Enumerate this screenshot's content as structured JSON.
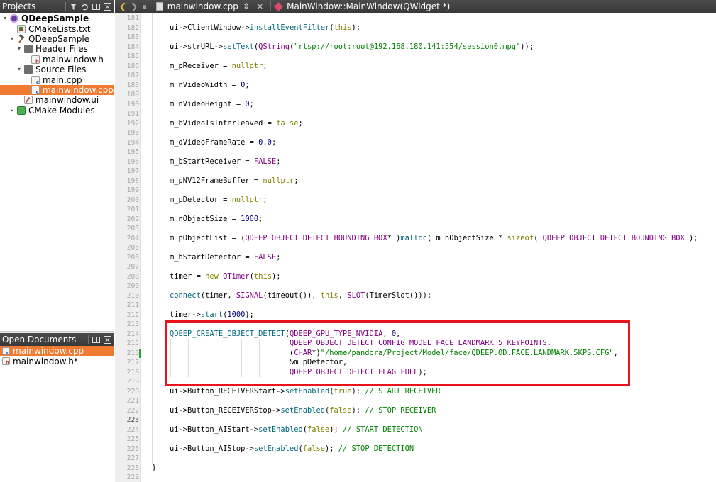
{
  "projects_panel": {
    "title": "Projects",
    "tree": [
      {
        "label": "QDeepSample",
        "icon": "project-icon",
        "depth": 0,
        "expanded": true,
        "bold": true
      },
      {
        "label": "CMakeLists.txt",
        "icon": "cmake-file-icon",
        "depth": 1
      },
      {
        "label": "QDeepSample",
        "icon": "hammer-icon",
        "depth": 1,
        "expanded": true
      },
      {
        "label": "Header Files",
        "icon": "folder-icon",
        "depth": 2,
        "expanded": true
      },
      {
        "label": "mainwindow.h",
        "icon": "header-file-icon",
        "depth": 3
      },
      {
        "label": "Source Files",
        "icon": "folder-icon",
        "depth": 2,
        "expanded": true
      },
      {
        "label": "main.cpp",
        "icon": "cpp-file-icon",
        "depth": 3
      },
      {
        "label": "mainwindow.cpp",
        "icon": "cpp-file-icon",
        "depth": 3,
        "selected": true
      },
      {
        "label": "mainwindow.ui",
        "icon": "ui-file-icon",
        "depth": 2
      },
      {
        "label": "CMake Modules",
        "icon": "cmake-modules-icon",
        "depth": 1,
        "expanded": false
      }
    ]
  },
  "open_documents": {
    "title": "Open Documents",
    "items": [
      {
        "label": "mainwindow.cpp",
        "selected": true
      },
      {
        "label": "mainwindow.h*",
        "selected": false
      }
    ]
  },
  "editor": {
    "file_tab": "mainwindow.cpp",
    "function_tab": "MainWindow::MainWindow(QWidget *)",
    "current_line": "223",
    "lines": [
      {
        "n": "181",
        "code": []
      },
      {
        "n": "182",
        "code": [
          [
            "    ui->",
            "k-mem"
          ],
          [
            "ClientWindow",
            "k-mem"
          ],
          [
            "->",
            "k-mem"
          ],
          [
            "installEventFilter",
            "k-func"
          ],
          [
            "(",
            ""
          ],
          [
            "this",
            "k-kw"
          ],
          [
            ");",
            ""
          ]
        ]
      },
      {
        "n": "183",
        "code": []
      },
      {
        "n": "184",
        "code": [
          [
            "    ui->",
            "k-mem"
          ],
          [
            "strURL",
            "k-mem"
          ],
          [
            "->",
            "k-mem"
          ],
          [
            "setText",
            "k-func"
          ],
          [
            "(",
            ""
          ],
          [
            "QString",
            "k-type"
          ],
          [
            "(",
            ""
          ],
          [
            "\"rtsp://root:root@192.168.180.141:554/session0.mpg\"",
            "k-str"
          ],
          [
            "));",
            ""
          ]
        ]
      },
      {
        "n": "185",
        "code": []
      },
      {
        "n": "186",
        "code": [
          [
            "    m_pReceiver",
            "k-mem"
          ],
          [
            " = ",
            ""
          ],
          [
            "nullptr",
            "k-kw"
          ],
          [
            ";",
            ""
          ]
        ]
      },
      {
        "n": "187",
        "code": []
      },
      {
        "n": "188",
        "code": [
          [
            "    m_nVideoWidth",
            "k-mem"
          ],
          [
            " = ",
            ""
          ],
          [
            "0",
            "k-num"
          ],
          [
            ";",
            ""
          ]
        ]
      },
      {
        "n": "189",
        "code": []
      },
      {
        "n": "190",
        "code": [
          [
            "    m_nVideoHeight",
            "k-mem"
          ],
          [
            " = ",
            ""
          ],
          [
            "0",
            "k-num"
          ],
          [
            ";",
            ""
          ]
        ]
      },
      {
        "n": "191",
        "code": []
      },
      {
        "n": "192",
        "code": [
          [
            "    m_bVideoIsInterleaved",
            "k-mem"
          ],
          [
            " = ",
            ""
          ],
          [
            "false",
            "k-kw"
          ],
          [
            ";",
            ""
          ]
        ]
      },
      {
        "n": "193",
        "code": []
      },
      {
        "n": "194",
        "code": [
          [
            "    m_dVideoFrameRate",
            "k-mem"
          ],
          [
            " = ",
            ""
          ],
          [
            "0.0",
            "k-num"
          ],
          [
            ";",
            ""
          ]
        ]
      },
      {
        "n": "195",
        "code": []
      },
      {
        "n": "196",
        "code": [
          [
            "    m_bStartReceiver",
            "k-mem"
          ],
          [
            " = ",
            ""
          ],
          [
            "FALSE",
            "k-macro"
          ],
          [
            ";",
            ""
          ]
        ]
      },
      {
        "n": "197",
        "code": []
      },
      {
        "n": "198",
        "code": [
          [
            "    m_pNV12FrameBuffer",
            "k-mem"
          ],
          [
            " = ",
            ""
          ],
          [
            "nullptr",
            "k-kw"
          ],
          [
            ";",
            ""
          ]
        ]
      },
      {
        "n": "199",
        "code": []
      },
      {
        "n": "200",
        "code": [
          [
            "    m_pDetector",
            "k-mem"
          ],
          [
            " = ",
            ""
          ],
          [
            "nullptr",
            "k-kw"
          ],
          [
            ";",
            ""
          ]
        ]
      },
      {
        "n": "201",
        "code": []
      },
      {
        "n": "202",
        "code": [
          [
            "    m_nObjectSize",
            "k-mem"
          ],
          [
            " = ",
            ""
          ],
          [
            "1000",
            "k-num"
          ],
          [
            ";",
            ""
          ]
        ]
      },
      {
        "n": "203",
        "code": []
      },
      {
        "n": "204",
        "code": [
          [
            "    m_pObjectList",
            "k-mem"
          ],
          [
            " = (",
            ""
          ],
          [
            "QDEEP_OBJECT_DETECT_BOUNDING_BOX",
            "k-type"
          ],
          [
            "* )",
            ""
          ],
          [
            "malloc",
            "k-func"
          ],
          [
            "( ",
            ""
          ],
          [
            "m_nObjectSize",
            "k-mem"
          ],
          [
            " * ",
            ""
          ],
          [
            "sizeof",
            "k-kw"
          ],
          [
            "( ",
            ""
          ],
          [
            "QDEEP_OBJECT_DETECT_BOUNDING_BOX",
            "k-type"
          ],
          [
            " );",
            ""
          ]
        ]
      },
      {
        "n": "205",
        "code": []
      },
      {
        "n": "206",
        "code": [
          [
            "    m_bStartDetector",
            "k-mem"
          ],
          [
            " = ",
            ""
          ],
          [
            "FALSE",
            "k-macro"
          ],
          [
            ";",
            ""
          ]
        ]
      },
      {
        "n": "207",
        "code": []
      },
      {
        "n": "208",
        "code": [
          [
            "    timer",
            "k-mem"
          ],
          [
            " = ",
            ""
          ],
          [
            "new",
            "k-kw"
          ],
          [
            " ",
            ""
          ],
          [
            "QTimer",
            "k-type"
          ],
          [
            "(",
            ""
          ],
          [
            "this",
            "k-kw"
          ],
          [
            ");",
            ""
          ]
        ]
      },
      {
        "n": "209",
        "code": []
      },
      {
        "n": "210",
        "code": [
          [
            "    ",
            ""
          ],
          [
            "connect",
            "k-func"
          ],
          [
            "(",
            ""
          ],
          [
            "timer",
            "k-mem"
          ],
          [
            ", ",
            ""
          ],
          [
            "SIGNAL",
            "k-macro"
          ],
          [
            "(timeout()), ",
            ""
          ],
          [
            "this",
            "k-kw"
          ],
          [
            ", ",
            ""
          ],
          [
            "SLOT",
            "k-macro"
          ],
          [
            "(TimerSlot()));",
            ""
          ]
        ]
      },
      {
        "n": "211",
        "code": []
      },
      {
        "n": "212",
        "code": [
          [
            "    timer",
            "k-mem"
          ],
          [
            "->",
            ""
          ],
          [
            "start",
            "k-func"
          ],
          [
            "(",
            ""
          ],
          [
            "1000",
            "k-num"
          ],
          [
            ");",
            ""
          ]
        ]
      },
      {
        "n": "213",
        "code": []
      },
      {
        "n": "214",
        "code": [
          [
            "    ",
            ""
          ],
          [
            "QDEEP_CREATE_OBJECT_DETECT",
            "k-func"
          ],
          [
            "(",
            ""
          ],
          [
            "QDEEP_GPU_TYPE_NVIDIA",
            "k-type"
          ],
          [
            ", ",
            ""
          ],
          [
            "0",
            "k-num"
          ],
          [
            ",",
            ""
          ]
        ]
      },
      {
        "n": "215",
        "code": [
          [
            "                               ",
            ""
          ],
          [
            "QDEEP_OBJECT_DETECT_CONFIG_MODEL_FACE_LANDMARK_5_KEYPOINTS",
            "k-type"
          ],
          [
            ",",
            ""
          ]
        ]
      },
      {
        "n": "216",
        "code": [
          [
            "                               (",
            ""
          ],
          [
            "CHAR",
            "k-type"
          ],
          [
            "*)",
            ""
          ],
          [
            "\"/home/pandora/Project/Model/face/QDEEP.OD.FACE.LANDMARK.5KPS.CFG\"",
            "k-str"
          ],
          [
            ",",
            ""
          ]
        ]
      },
      {
        "n": "217",
        "code": [
          [
            "                               &",
            ""
          ],
          [
            "m_pDetector",
            "k-mem"
          ],
          [
            ",",
            ""
          ]
        ]
      },
      {
        "n": "218",
        "code": [
          [
            "                               ",
            ""
          ],
          [
            "QDEEP_OBJECT_DETECT_FLAG_FULL",
            "k-type"
          ],
          [
            ");",
            ""
          ]
        ]
      },
      {
        "n": "219",
        "code": []
      },
      {
        "n": "220",
        "code": [
          [
            "    ui->",
            "k-mem"
          ],
          [
            "Button_RECEIVERStart",
            "k-mem"
          ],
          [
            "->",
            ""
          ],
          [
            "setEnabled",
            "k-func"
          ],
          [
            "(",
            ""
          ],
          [
            "true",
            "k-kw"
          ],
          [
            "); ",
            ""
          ],
          [
            "// START RECEIVER",
            "k-com"
          ]
        ]
      },
      {
        "n": "221",
        "code": []
      },
      {
        "n": "222",
        "code": [
          [
            "    ui->",
            "k-mem"
          ],
          [
            "Button_RECEIVERStop",
            "k-mem"
          ],
          [
            "->",
            ""
          ],
          [
            "setEnabled",
            "k-func"
          ],
          [
            "(",
            ""
          ],
          [
            "false",
            "k-kw"
          ],
          [
            "); ",
            ""
          ],
          [
            "// STOP RECEIVER",
            "k-com"
          ]
        ]
      },
      {
        "n": "223",
        "code": []
      },
      {
        "n": "224",
        "code": [
          [
            "    ui->",
            "k-mem"
          ],
          [
            "Button_AIStart",
            "k-mem"
          ],
          [
            "->",
            ""
          ],
          [
            "setEnabled",
            "k-func"
          ],
          [
            "(",
            ""
          ],
          [
            "false",
            "k-kw"
          ],
          [
            "); ",
            ""
          ],
          [
            "// START DETECTION",
            "k-com"
          ]
        ]
      },
      {
        "n": "225",
        "code": []
      },
      {
        "n": "226",
        "code": [
          [
            "    ui->",
            "k-mem"
          ],
          [
            "Button_AIStop",
            "k-mem"
          ],
          [
            "->",
            ""
          ],
          [
            "setEnabled",
            "k-func"
          ],
          [
            "(",
            ""
          ],
          [
            "false",
            "k-kw"
          ],
          [
            "); ",
            ""
          ],
          [
            "// STOP DETECTION",
            "k-com"
          ]
        ]
      },
      {
        "n": "227",
        "code": []
      },
      {
        "n": "228",
        "code": [
          [
            "}",
            ""
          ]
        ]
      },
      {
        "n": "229",
        "code": []
      }
    ]
  },
  "colors": {
    "selection": "#f07a32",
    "highlight_box": "#e8141b",
    "panel_header": "#404040"
  }
}
